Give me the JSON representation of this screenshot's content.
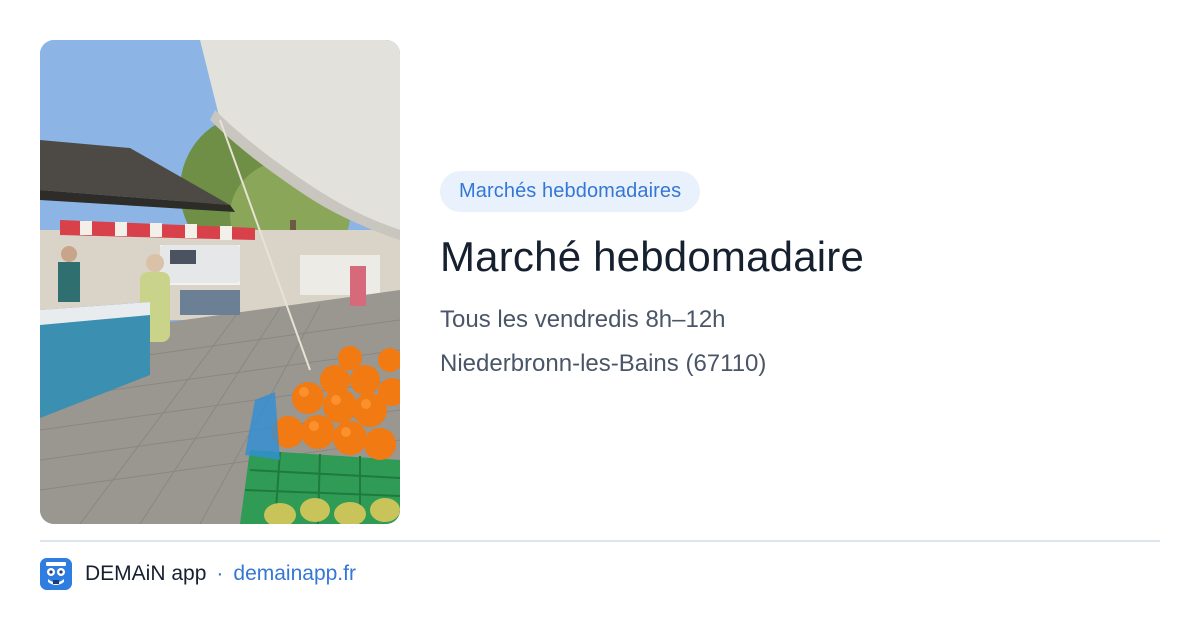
{
  "photo": {
    "icon": "market-stall-photo"
  },
  "event": {
    "category": "Marchés hebdomadaires",
    "title": "Marché hebdomadaire",
    "schedule": "Tous les vendredis 8h–12h",
    "location": "Niederbronn-les-Bains (67110)"
  },
  "footer": {
    "app_name": "DEMAiN app",
    "separator": "·",
    "link": "demainapp.fr",
    "logo_icon": "demain-logo-icon"
  },
  "colors": {
    "accent": "#3577d4",
    "badge_background": "#e8f1fc",
    "title": "#16202f",
    "body_text": "#4a5667",
    "divider": "#dde6ec",
    "logo": "#2f7de1"
  }
}
